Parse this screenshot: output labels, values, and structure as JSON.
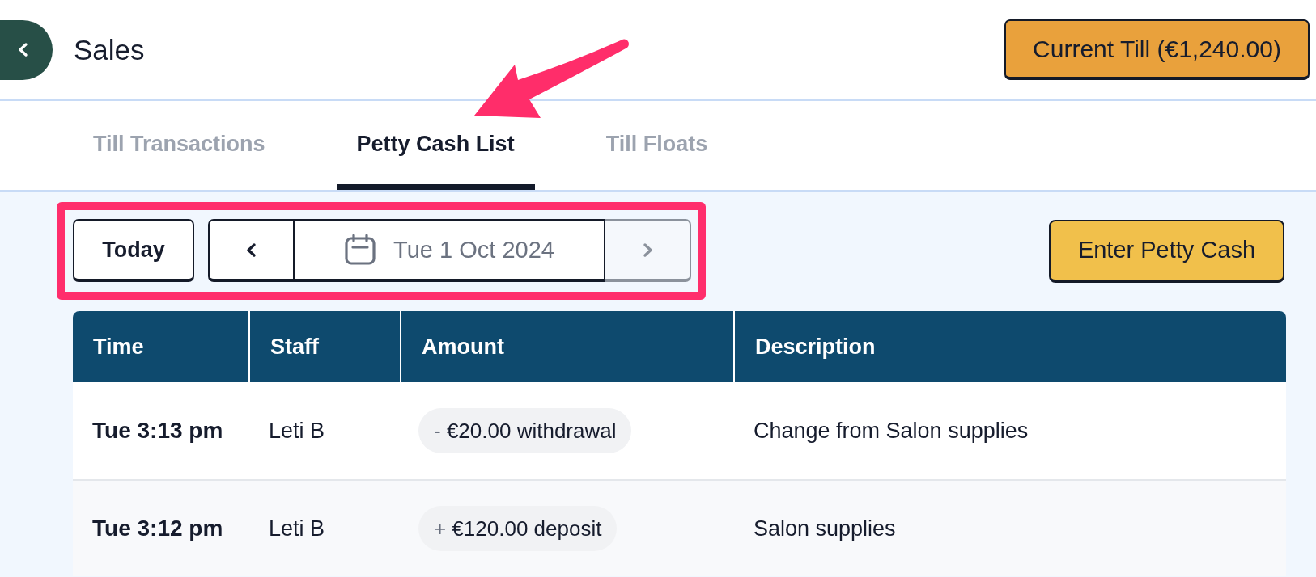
{
  "header": {
    "title": "Sales",
    "till_button": "Current Till (€1,240.00)"
  },
  "tabs": [
    {
      "label": "Till Transactions",
      "selected": false
    },
    {
      "label": "Petty Cash List",
      "selected": true
    },
    {
      "label": "Till Floats",
      "selected": false
    }
  ],
  "toolbar": {
    "today_button": "Today",
    "previous_disabled": false,
    "date": "Tue 1 Oct 2024",
    "next_disabled": true,
    "enter_button": "Enter Petty Cash"
  },
  "table": {
    "columns": [
      "Time",
      "Staff",
      "Amount",
      "Description"
    ],
    "rows": [
      {
        "time": "Tue 3:13 pm",
        "staff": "Leti B",
        "amount": {
          "sign": "-",
          "text": "€20.00 withdrawal"
        },
        "description": "Change from Salon supplies"
      },
      {
        "time": "Tue 3:12 pm",
        "staff": "Leti B",
        "amount": {
          "sign": "+",
          "text": "€120.00 deposit"
        },
        "description": "Salon supplies"
      }
    ]
  },
  "annotations": {
    "arrow": true,
    "frame": true
  }
}
